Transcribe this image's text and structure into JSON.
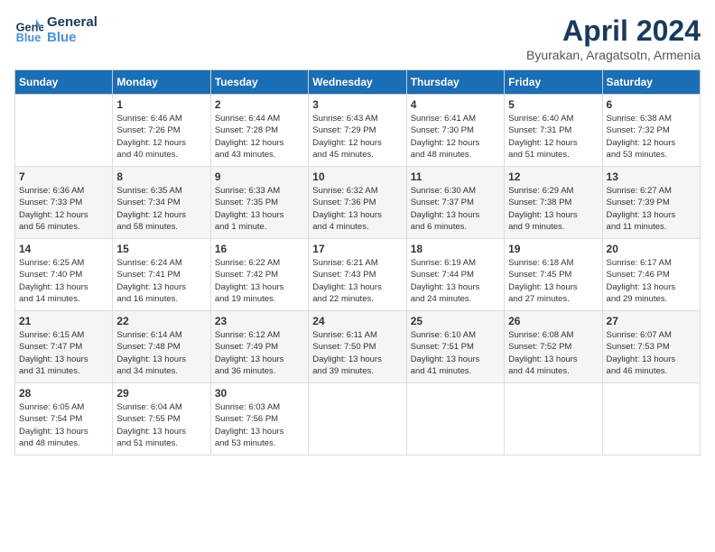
{
  "logo": {
    "line1": "General",
    "line2": "Blue"
  },
  "title": "April 2024",
  "subtitle": "Byurakan, Aragatsotn, Armenia",
  "weekdays": [
    "Sunday",
    "Monday",
    "Tuesday",
    "Wednesday",
    "Thursday",
    "Friday",
    "Saturday"
  ],
  "weeks": [
    [
      {
        "day": "",
        "info": ""
      },
      {
        "day": "1",
        "info": "Sunrise: 6:46 AM\nSunset: 7:26 PM\nDaylight: 12 hours\nand 40 minutes."
      },
      {
        "day": "2",
        "info": "Sunrise: 6:44 AM\nSunset: 7:28 PM\nDaylight: 12 hours\nand 43 minutes."
      },
      {
        "day": "3",
        "info": "Sunrise: 6:43 AM\nSunset: 7:29 PM\nDaylight: 12 hours\nand 45 minutes."
      },
      {
        "day": "4",
        "info": "Sunrise: 6:41 AM\nSunset: 7:30 PM\nDaylight: 12 hours\nand 48 minutes."
      },
      {
        "day": "5",
        "info": "Sunrise: 6:40 AM\nSunset: 7:31 PM\nDaylight: 12 hours\nand 51 minutes."
      },
      {
        "day": "6",
        "info": "Sunrise: 6:38 AM\nSunset: 7:32 PM\nDaylight: 12 hours\nand 53 minutes."
      }
    ],
    [
      {
        "day": "7",
        "info": "Sunrise: 6:36 AM\nSunset: 7:33 PM\nDaylight: 12 hours\nand 56 minutes."
      },
      {
        "day": "8",
        "info": "Sunrise: 6:35 AM\nSunset: 7:34 PM\nDaylight: 12 hours\nand 58 minutes."
      },
      {
        "day": "9",
        "info": "Sunrise: 6:33 AM\nSunset: 7:35 PM\nDaylight: 13 hours\nand 1 minute."
      },
      {
        "day": "10",
        "info": "Sunrise: 6:32 AM\nSunset: 7:36 PM\nDaylight: 13 hours\nand 4 minutes."
      },
      {
        "day": "11",
        "info": "Sunrise: 6:30 AM\nSunset: 7:37 PM\nDaylight: 13 hours\nand 6 minutes."
      },
      {
        "day": "12",
        "info": "Sunrise: 6:29 AM\nSunset: 7:38 PM\nDaylight: 13 hours\nand 9 minutes."
      },
      {
        "day": "13",
        "info": "Sunrise: 6:27 AM\nSunset: 7:39 PM\nDaylight: 13 hours\nand 11 minutes."
      }
    ],
    [
      {
        "day": "14",
        "info": "Sunrise: 6:25 AM\nSunset: 7:40 PM\nDaylight: 13 hours\nand 14 minutes."
      },
      {
        "day": "15",
        "info": "Sunrise: 6:24 AM\nSunset: 7:41 PM\nDaylight: 13 hours\nand 16 minutes."
      },
      {
        "day": "16",
        "info": "Sunrise: 6:22 AM\nSunset: 7:42 PM\nDaylight: 13 hours\nand 19 minutes."
      },
      {
        "day": "17",
        "info": "Sunrise: 6:21 AM\nSunset: 7:43 PM\nDaylight: 13 hours\nand 22 minutes."
      },
      {
        "day": "18",
        "info": "Sunrise: 6:19 AM\nSunset: 7:44 PM\nDaylight: 13 hours\nand 24 minutes."
      },
      {
        "day": "19",
        "info": "Sunrise: 6:18 AM\nSunset: 7:45 PM\nDaylight: 13 hours\nand 27 minutes."
      },
      {
        "day": "20",
        "info": "Sunrise: 6:17 AM\nSunset: 7:46 PM\nDaylight: 13 hours\nand 29 minutes."
      }
    ],
    [
      {
        "day": "21",
        "info": "Sunrise: 6:15 AM\nSunset: 7:47 PM\nDaylight: 13 hours\nand 31 minutes."
      },
      {
        "day": "22",
        "info": "Sunrise: 6:14 AM\nSunset: 7:48 PM\nDaylight: 13 hours\nand 34 minutes."
      },
      {
        "day": "23",
        "info": "Sunrise: 6:12 AM\nSunset: 7:49 PM\nDaylight: 13 hours\nand 36 minutes."
      },
      {
        "day": "24",
        "info": "Sunrise: 6:11 AM\nSunset: 7:50 PM\nDaylight: 13 hours\nand 39 minutes."
      },
      {
        "day": "25",
        "info": "Sunrise: 6:10 AM\nSunset: 7:51 PM\nDaylight: 13 hours\nand 41 minutes."
      },
      {
        "day": "26",
        "info": "Sunrise: 6:08 AM\nSunset: 7:52 PM\nDaylight: 13 hours\nand 44 minutes."
      },
      {
        "day": "27",
        "info": "Sunrise: 6:07 AM\nSunset: 7:53 PM\nDaylight: 13 hours\nand 46 minutes."
      }
    ],
    [
      {
        "day": "28",
        "info": "Sunrise: 6:05 AM\nSunset: 7:54 PM\nDaylight: 13 hours\nand 48 minutes."
      },
      {
        "day": "29",
        "info": "Sunrise: 6:04 AM\nSunset: 7:55 PM\nDaylight: 13 hours\nand 51 minutes."
      },
      {
        "day": "30",
        "info": "Sunrise: 6:03 AM\nSunset: 7:56 PM\nDaylight: 13 hours\nand 53 minutes."
      },
      {
        "day": "",
        "info": ""
      },
      {
        "day": "",
        "info": ""
      },
      {
        "day": "",
        "info": ""
      },
      {
        "day": "",
        "info": ""
      }
    ]
  ]
}
